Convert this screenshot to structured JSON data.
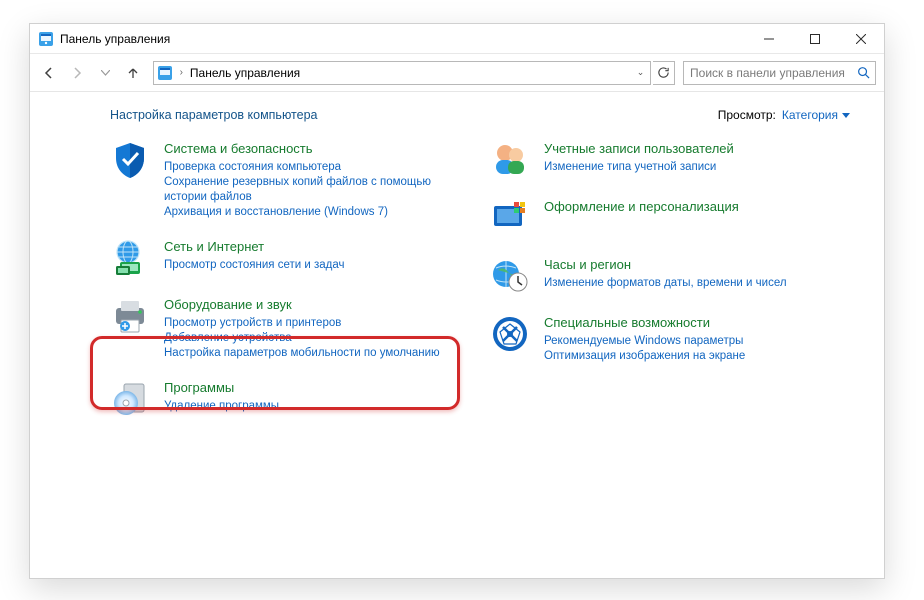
{
  "window": {
    "title": "Панель управления"
  },
  "nav": {
    "breadcrumb_root": "Панель управления",
    "search_placeholder": "Поиск в панели управления"
  },
  "header": {
    "heading": "Настройка параметров компьютера",
    "view_label": "Просмотр:",
    "view_value": "Категория"
  },
  "left": [
    {
      "id": "system-security",
      "title": "Система и безопасность",
      "links": [
        "Проверка состояния компьютера",
        "Сохранение резервных копий файлов с помощью истории файлов",
        "Архивация и восстановление (Windows 7)"
      ]
    },
    {
      "id": "network",
      "title": "Сеть и Интернет",
      "links": [
        "Просмотр состояния сети и задач"
      ]
    },
    {
      "id": "hardware-sound",
      "title": "Оборудование и звук",
      "links": [
        "Просмотр устройств и принтеров",
        "Добавление устройства",
        "Настройка параметров мобильности по умолчанию"
      ]
    },
    {
      "id": "programs",
      "title": "Программы",
      "links": [
        "Удаление программы"
      ]
    }
  ],
  "right": [
    {
      "id": "user-accounts",
      "title": "Учетные записи пользователей",
      "links": [
        "Изменение типа учетной записи"
      ]
    },
    {
      "id": "appearance",
      "title": "Оформление и персонализация",
      "links": []
    },
    {
      "id": "clock-region",
      "title": "Часы и регион",
      "links": [
        "Изменение форматов даты, времени и чисел"
      ]
    },
    {
      "id": "ease-of-access",
      "title": "Специальные возможности",
      "links": [
        "Рекомендуемые Windows параметры",
        "Оптимизация изображения на экране"
      ]
    }
  ]
}
